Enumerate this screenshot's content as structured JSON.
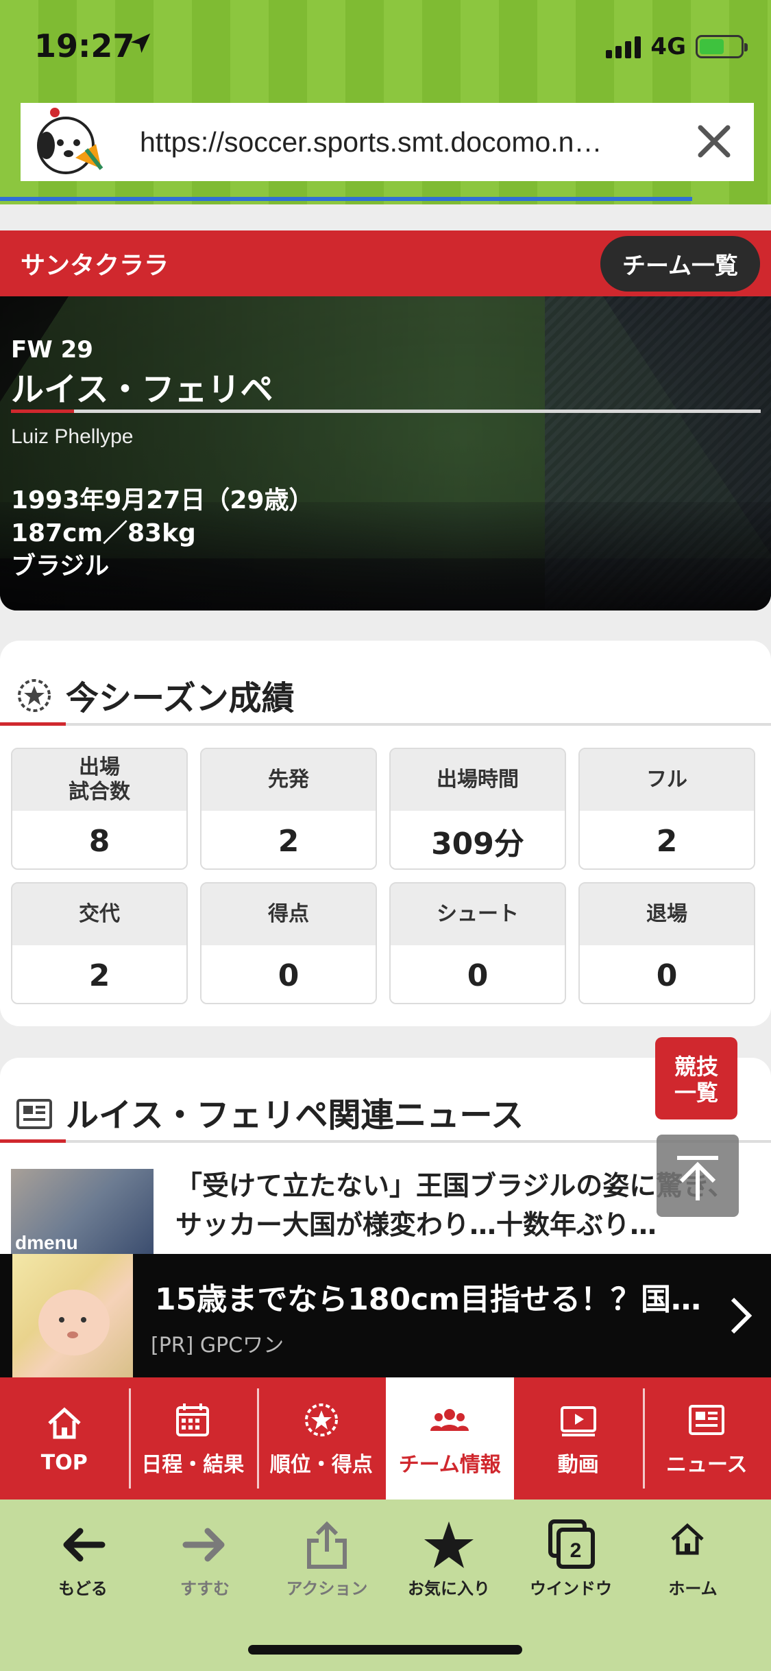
{
  "status": {
    "time": "19:27",
    "network": "4G"
  },
  "browser": {
    "url": "https://soccer.sports.smt.docomo.ne.jp/…",
    "url_display": "https://soccer.sports.smt.docomo.n…"
  },
  "team": {
    "name": "サンタクララ",
    "list_button": "チーム一覧"
  },
  "player": {
    "position_number": "FW 29",
    "name": "ルイス・フェリペ",
    "latin_name": "Luiz Phellype",
    "birth": "1993年9月27日（29歳）",
    "body": "187cm／83kg",
    "nationality": "ブラジル"
  },
  "stats": {
    "title": "今シーズン成績",
    "items": [
      {
        "label": "出場\n試合数",
        "value": "8"
      },
      {
        "label": "先発",
        "value": "2"
      },
      {
        "label": "出場時間",
        "value": "309分"
      },
      {
        "label": "フル",
        "value": "2"
      },
      {
        "label": "交代",
        "value": "2"
      },
      {
        "label": "得点",
        "value": "0"
      },
      {
        "label": "シュート",
        "value": "0"
      },
      {
        "label": "退場",
        "value": "0"
      }
    ]
  },
  "news": {
    "title": "ルイス・フェリペ関連ニュース",
    "items": [
      {
        "thumb_label": "dmenu",
        "title": "「受けて立たない」王国ブラジルの姿に驚き、サッカー大国が様変わり…十数年ぶり…"
      }
    ]
  },
  "floating": {
    "game_list": "競技\n一覧"
  },
  "ad": {
    "title": "15歳までなら180cm目指せる！？国…",
    "sponsor": "[PR] GPCワン"
  },
  "site_nav": [
    {
      "label": "TOP",
      "icon": "home-icon"
    },
    {
      "label": "日程・結果",
      "icon": "calendar-icon"
    },
    {
      "label": "順位・得点",
      "icon": "trophy-icon"
    },
    {
      "label": "チーム情報",
      "icon": "team-icon",
      "active": true
    },
    {
      "label": "動画",
      "icon": "video-icon"
    },
    {
      "label": "ニュース",
      "icon": "news-icon"
    }
  ],
  "toolbar": [
    {
      "label": "もどる",
      "icon": "back-arrow-icon"
    },
    {
      "label": "すすむ",
      "icon": "forward-arrow-icon"
    },
    {
      "label": "アクション",
      "icon": "share-icon"
    },
    {
      "label": "お気に入り",
      "icon": "star-icon"
    },
    {
      "label": "ウインドウ",
      "icon": "windows-icon",
      "badge": "2"
    },
    {
      "label": "ホーム",
      "icon": "home-icon"
    }
  ],
  "colors": {
    "brand_red": "#d0282e",
    "chrome_green": "#8cc63f",
    "toolbar_green": "#c4dc9c"
  }
}
